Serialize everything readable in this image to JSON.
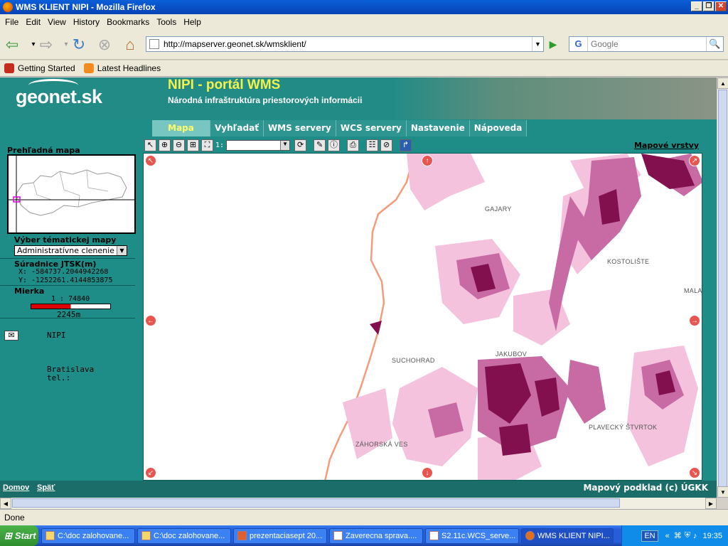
{
  "window": {
    "title": "WMS KLIENT NIPI - Mozilla Firefox"
  },
  "menu": [
    "File",
    "Edit",
    "View",
    "History",
    "Bookmarks",
    "Tools",
    "Help"
  ],
  "nav": {
    "url": "http://mapserver.geonet.sk/wmsklient/",
    "search_placeholder": "Google"
  },
  "bookmarks": [
    {
      "label": "Getting Started",
      "icon": "firefox-bookmark-icon"
    },
    {
      "label": "Latest Headlines",
      "icon": "rss-feed-icon"
    }
  ],
  "site": {
    "logo": "geonet.sk",
    "title": "NIPI - portál WMS",
    "subtitle": "Národná infraštruktúra priestorových informácii",
    "tabs": [
      "Mapa",
      "Vyhľadať",
      "WMS servery",
      "WCS servery",
      "Nastavenie",
      "Nápoveda"
    ],
    "active_tab": "Mapa"
  },
  "sidebar": {
    "overview_label": "Prehľadná mapa",
    "theme_label": "Výber tématickej mapy",
    "theme_value": "Administratívne clenenie",
    "coords_label": "Súradnice JTSK(m)",
    "x": "X: -584737.2044942268",
    "y": "Y: -1252261.4144853875",
    "scale_label": "Mierka",
    "scale_value": "1 : 74840",
    "scale_length": "2245m",
    "contact_name": "NIPI",
    "contact_city": "Bratislava",
    "contact_tel": "tel.:"
  },
  "map": {
    "scale_prefix": "1:",
    "layers_link": "Mapové vrstvy",
    "places": [
      "GAJARY",
      "KOSTOLIŠTE",
      "MALA",
      "JAKUBOV",
      "SUCHOHRAD",
      "PLAVECKÝ ŠTVRTOK",
      "ZÁHORSKÁ VES"
    ]
  },
  "footer": {
    "home": "Domov",
    "back": "Späť",
    "credit": "Mapový podklad (c) ÚGKK"
  },
  "status": "Done",
  "taskbar": {
    "start": "Start",
    "tasks": [
      "C:\\doc zalohovane...",
      "C:\\doc zalohovane...",
      "prezentaciasept 20...",
      "Zaverecna sprava....",
      "S2.11c.WCS_serve...",
      "WMS KLIENT NIPI..."
    ],
    "lang": "EN",
    "time": "19:35"
  }
}
